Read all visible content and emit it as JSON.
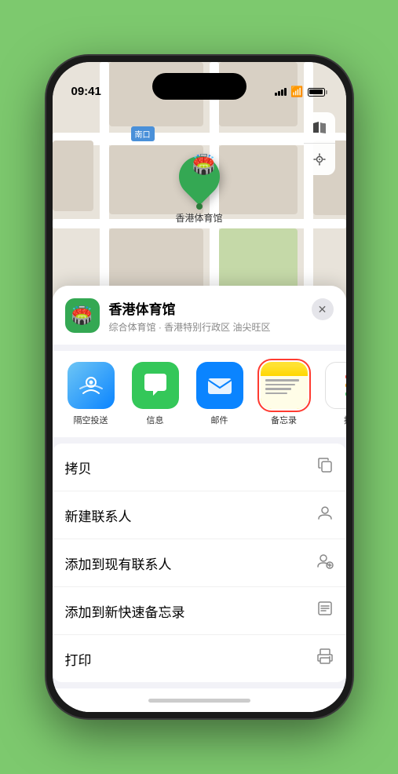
{
  "status_bar": {
    "time": "09:41",
    "signal_label": "signal",
    "wifi_label": "wifi",
    "battery_label": "battery"
  },
  "map": {
    "road_label": "南口",
    "pin_label": "香港体育馆",
    "controls": {
      "map_type_label": "map-type",
      "location_label": "location"
    }
  },
  "place_card": {
    "name": "香港体育馆",
    "subtitle": "综合体育馆 · 香港特别行政区 油尖旺区",
    "close_label": "✕"
  },
  "share_row": {
    "items": [
      {
        "id": "airdrop",
        "label": "隔空投送",
        "type": "airdrop"
      },
      {
        "id": "messages",
        "label": "信息",
        "type": "messages"
      },
      {
        "id": "mail",
        "label": "邮件",
        "type": "mail"
      },
      {
        "id": "notes",
        "label": "备忘录",
        "type": "notes",
        "selected": true
      },
      {
        "id": "more",
        "label": "提",
        "type": "more"
      }
    ]
  },
  "actions": [
    {
      "label": "拷贝",
      "icon": "copy"
    },
    {
      "label": "新建联系人",
      "icon": "person"
    },
    {
      "label": "添加到现有联系人",
      "icon": "person-add"
    },
    {
      "label": "添加到新快速备忘录",
      "icon": "note"
    },
    {
      "label": "打印",
      "icon": "print"
    }
  ]
}
